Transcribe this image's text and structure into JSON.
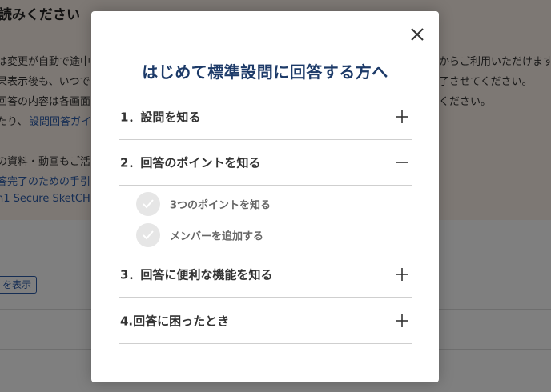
{
  "background": {
    "title": "読みください",
    "lines": [
      "は変更が自動で途中",
      "果表示後も、いつで",
      "回答の内容は各画面",
      "たり、"
    ],
    "guide_link": "設問回答ガイ",
    "right_lines": [
      "からご利用いただけます",
      "了させてください。",
      "ください。"
    ],
    "lower_lines": [
      "の資料・動画もご活",
      "答完了のための手引",
      "n1 Secure SketCH"
    ],
    "show_button": "を表示"
  },
  "modal": {
    "title": "はじめて標準設問に回答する方へ",
    "close_icon": "close-icon",
    "sections": [
      {
        "label": "1．設問を知る",
        "toggle": "plus-icon"
      },
      {
        "label": "2．回答のポイントを知る",
        "toggle": "minus-icon"
      },
      {
        "label": "3．回答に便利な機能を知る",
        "toggle": "plus-icon"
      },
      {
        "label": "4.回答に困ったとき",
        "toggle": "plus-icon"
      }
    ],
    "subitems": [
      {
        "label": "3つのポイントを知る",
        "icon": "check-icon"
      },
      {
        "label": "メンバーを追加する",
        "icon": "check-icon"
      }
    ]
  },
  "colors": {
    "title": "#1c3a68",
    "link": "#2a5aa8",
    "check_bg": "#e6e6e6"
  }
}
